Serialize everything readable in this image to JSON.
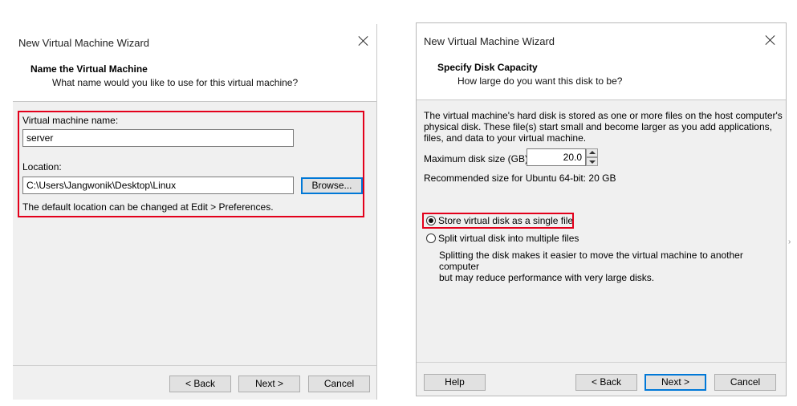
{
  "dialog1": {
    "title": "New Virtual Machine Wizard",
    "header_title": "Name the Virtual Machine",
    "header_sub": "What name would you like to use for this virtual machine?",
    "vm_name_label": "Virtual machine name:",
    "vm_name_value": "server",
    "location_label": "Location:",
    "location_value": "C:\\Users\\Jangwonik\\Desktop\\Linux",
    "browse_label": "Browse...",
    "default_location_note": "The default location can be changed at Edit > Preferences.",
    "back_label": "< Back",
    "next_label": "Next >",
    "cancel_label": "Cancel"
  },
  "dialog2": {
    "title": "New Virtual Machine Wizard",
    "header_title": "Specify Disk Capacity",
    "header_sub": "How large do you want this disk to be?",
    "description_lines": [
      "The virtual machine's hard disk is stored as one or more files on the host computer's",
      "physical disk. These file(s) start small and become larger as you add applications,",
      "files, and data to your virtual machine."
    ],
    "max_disk_label": "Maximum disk size (GB):",
    "max_disk_value": "20.0",
    "recommended_text": "Recommended size for Ubuntu 64-bit: 20 GB",
    "option_single": "Store virtual disk as a single file",
    "option_multiple": "Split virtual disk into multiple files",
    "option_multiple_desc_lines": [
      "Splitting the disk makes it easier to move the virtual machine to another computer",
      "but may reduce performance with very large disks."
    ],
    "help_label": "Help",
    "back_label": "< Back",
    "next_label": "Next >",
    "cancel_label": "Cancel"
  },
  "colors": {
    "highlight_red": "#e3001b",
    "focus_blue": "#0078d7",
    "dialog_bg": "#f0f0f0"
  }
}
